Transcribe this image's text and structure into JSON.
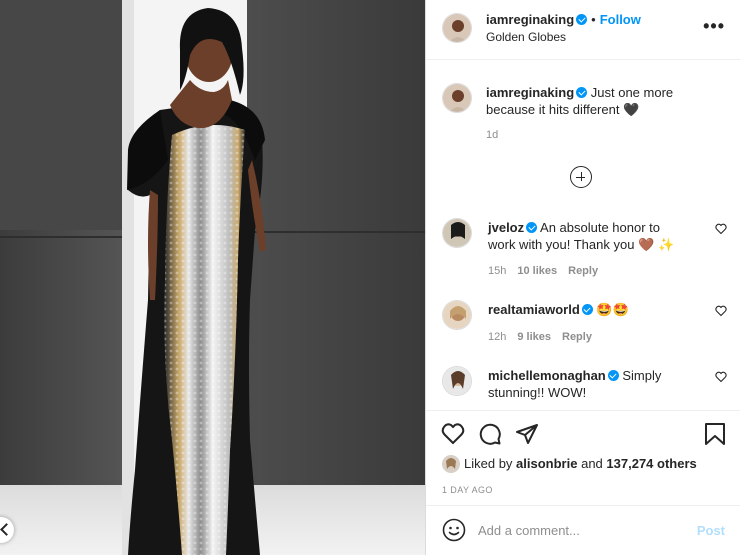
{
  "photo": {
    "alt_subject": "woman in silver sequin gown"
  },
  "post": {
    "username": "iamreginaking",
    "follow_separator": "•",
    "follow_label": "Follow",
    "location": "Golden Globes",
    "more_label": "•••"
  },
  "caption": {
    "username": "iamreginaking",
    "text": "Just one more because it hits different",
    "emoji": "🖤",
    "time": "1d"
  },
  "comments": [
    {
      "username": "jveloz",
      "text": "An absolute honor to work with you! Thank you",
      "emoji": "🤎 ✨",
      "time": "15h",
      "likes": "10 likes",
      "reply": "Reply"
    },
    {
      "username": "realtamiaworld",
      "text": "",
      "emoji": "🤩🤩",
      "time": "12h",
      "likes": "9 likes",
      "reply": "Reply"
    },
    {
      "username": "michellemonaghan",
      "text": "Simply stunning!! WOW!",
      "emoji": "",
      "time": "",
      "likes": "",
      "reply": ""
    }
  ],
  "likes": {
    "prefix": "Liked by",
    "user": "alisonbrie",
    "connector": "and",
    "count": "137,274 others"
  },
  "date": "1 DAY AGO",
  "add_comment": {
    "placeholder": "Add a comment...",
    "post_label": "Post"
  },
  "colors": {
    "accent": "#0095f6",
    "post_disabled": "#b2dffc",
    "muted": "#8e8e8e"
  },
  "icons": [
    "heart-icon",
    "comment-icon",
    "share-icon",
    "bookmark-icon",
    "emoji-icon",
    "plus-circle-icon",
    "chevron-left-icon"
  ]
}
